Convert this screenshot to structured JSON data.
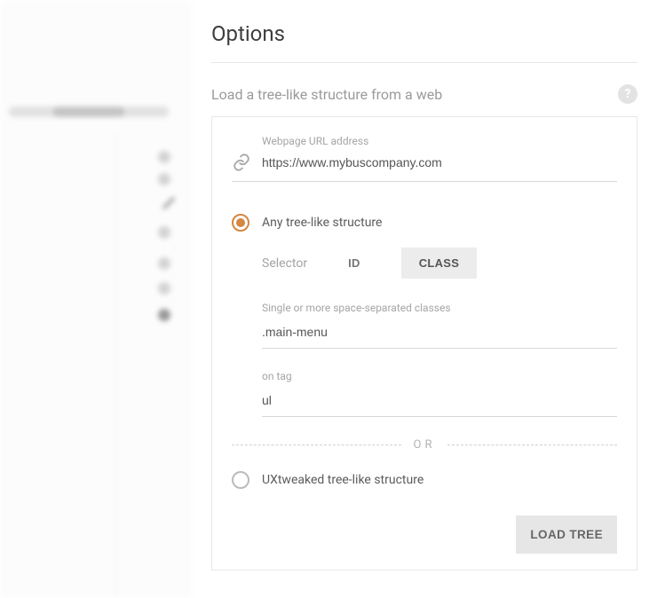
{
  "title": "Options",
  "section_title": "Load a tree-like structure from a web",
  "url_field": {
    "label": "Webpage URL address",
    "value": "https://www.mybuscompany.com"
  },
  "radio_any": {
    "label": "Any tree-like structure",
    "selected": true
  },
  "selector": {
    "lead": "Selector",
    "opt_id": "ID",
    "opt_class": "CLASS",
    "active": "CLASS"
  },
  "class_field": {
    "label": "Single or more space-separated classes",
    "value": ".main-menu"
  },
  "tag_field": {
    "label": "on tag",
    "value": "ul"
  },
  "or_label": "OR",
  "radio_ux": {
    "label": "UXtweaked tree-like structure",
    "selected": false
  },
  "load_button": "LOAD TREE"
}
